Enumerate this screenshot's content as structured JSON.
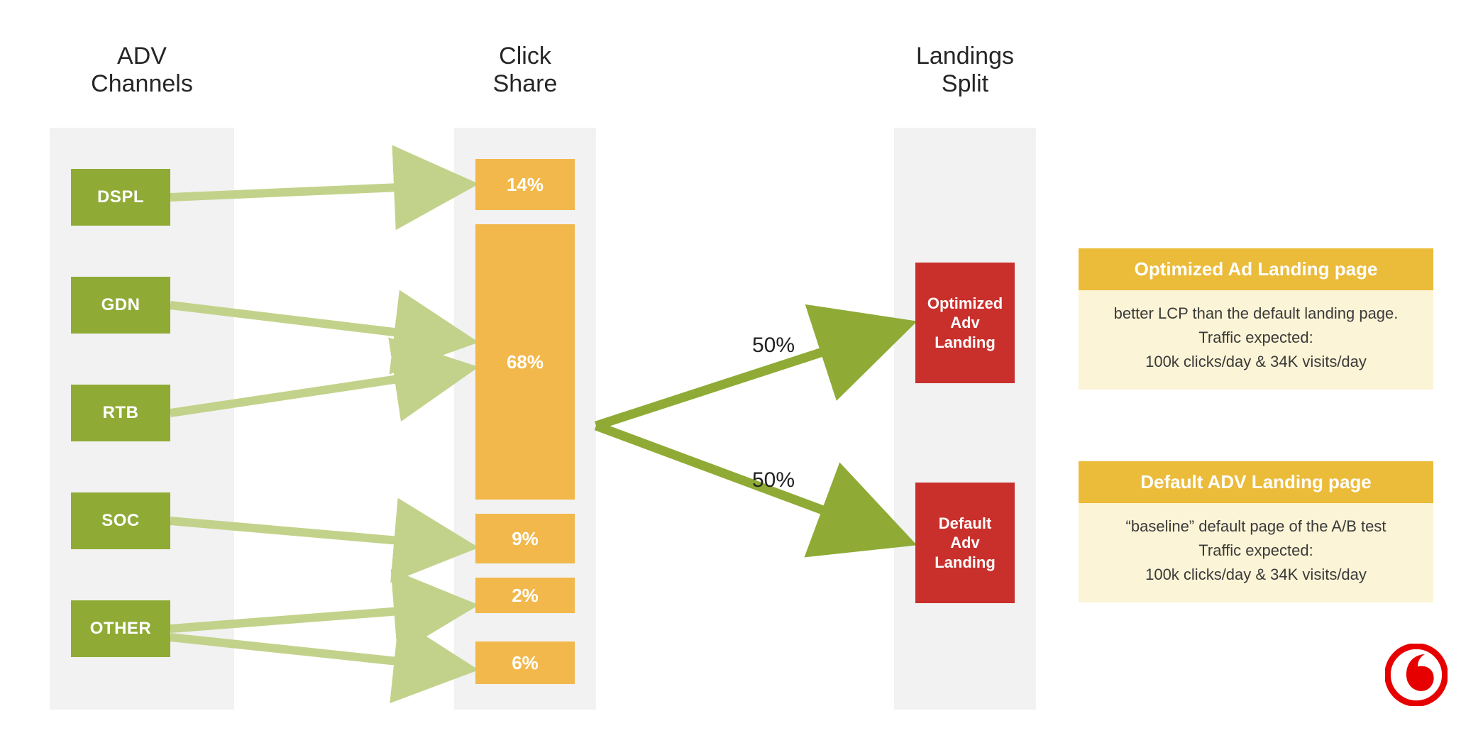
{
  "columns": {
    "adv": {
      "title_l1": "ADV",
      "title_l2": "Channels"
    },
    "click": {
      "title_l1": "Click",
      "title_l2": "Share"
    },
    "land": {
      "title_l1": "Landings",
      "title_l2": "Split"
    }
  },
  "channels": [
    {
      "label": "DSPL"
    },
    {
      "label": "GDN"
    },
    {
      "label": "RTB"
    },
    {
      "label": "SOC"
    },
    {
      "label": "OTHER"
    }
  ],
  "click_share": [
    {
      "pct": "14%"
    },
    {
      "pct": "68%"
    },
    {
      "pct": "9%"
    },
    {
      "pct": "2%"
    },
    {
      "pct": "6%"
    }
  ],
  "split": {
    "top_pct": "50%",
    "bot_pct": "50%"
  },
  "landings": {
    "optimized": {
      "l1": "Optimized",
      "l2": "Adv",
      "l3": "Landing"
    },
    "default": {
      "l1": "Default",
      "l2": "Adv",
      "l3": "Landing"
    }
  },
  "cards": {
    "optimized": {
      "title": "Optimized Ad Landing page",
      "body_l1": "better LCP than the default landing page.",
      "body_l2": "Traffic expected:",
      "body_l3": "100k clicks/day  & 34K visits/day"
    },
    "default": {
      "title": "Default ADV Landing page",
      "body_l1": "“baseline” default page of the A/B test",
      "body_l2": "Traffic expected:",
      "body_l3": "100k clicks/day  & 34K visits/day"
    }
  },
  "colors": {
    "green": "#8fab36",
    "green_arrow_light": "#c3d28a",
    "orange": "#f2b84b",
    "red": "#c9302c",
    "card_head": "#ebbb3a",
    "card_body": "#fcf4d6",
    "col_bg": "#f2f2f2"
  },
  "chart_data": {
    "type": "bar",
    "title": "ADV Channels → Click Share → Landings Split",
    "categories": [
      "DSPL",
      "GDN",
      "RTB",
      "SOC",
      "OTHER"
    ],
    "values_pct": [
      14,
      68,
      9,
      2,
      6
    ],
    "grouped_68": [
      "GDN",
      "RTB",
      "SOC"
    ],
    "split": {
      "Optimized Adv Landing": 50,
      "Default Adv Landing": 50
    },
    "landing_pages": [
      {
        "name": "Optimized Ad Landing page",
        "note": "better LCP than the default landing page",
        "expected_clicks_per_day": 100000,
        "expected_visits_per_day": 34000
      },
      {
        "name": "Default ADV Landing page",
        "note": "baseline default page of the A/B test",
        "expected_clicks_per_day": 100000,
        "expected_visits_per_day": 34000
      }
    ]
  }
}
